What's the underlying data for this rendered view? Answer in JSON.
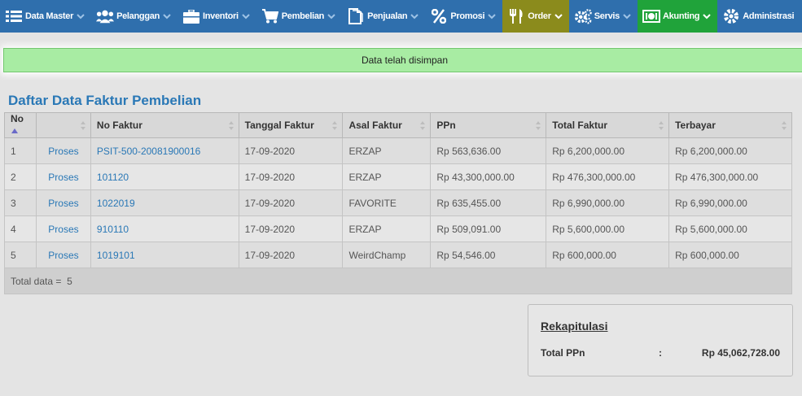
{
  "nav": [
    {
      "key": "data-master",
      "label": "Data Master",
      "icon": "list-icon"
    },
    {
      "key": "pelanggan",
      "label": "Pelanggan",
      "icon": "users-icon"
    },
    {
      "key": "inventori",
      "label": "Inventori",
      "icon": "briefcase-icon"
    },
    {
      "key": "pembelian",
      "label": "Pembelian",
      "icon": "cart-icon"
    },
    {
      "key": "penjualan",
      "label": "Penjualan",
      "icon": "document-icon"
    },
    {
      "key": "promosi",
      "label": "Promosi",
      "icon": "percent-icon"
    },
    {
      "key": "order",
      "label": "Order",
      "icon": "utensils-icon"
    },
    {
      "key": "servis",
      "label": "Servis",
      "icon": "gears-icon"
    },
    {
      "key": "akunting",
      "label": "Akunting",
      "icon": "money-icon"
    },
    {
      "key": "administrasi",
      "label": "Administrasi",
      "icon": "gear-icon"
    }
  ],
  "alert": {
    "message": "Data telah disimpan"
  },
  "page": {
    "title": "Daftar Data Faktur Pembelian"
  },
  "table": {
    "headers": {
      "no": "No",
      "aksi": "",
      "no_faktur": "No Faktur",
      "tanggal": "Tanggal Faktur",
      "asal": "Asal Faktur",
      "ppn": "PPn",
      "total": "Total Faktur",
      "terbayar": "Terbayar"
    },
    "rows": [
      {
        "no": "1",
        "aksi": "Proses",
        "no_faktur": "PSIT-500-20081900016",
        "tanggal": "17-09-2020",
        "asal": "ERZAP",
        "ppn": "Rp 563,636.00",
        "total": "Rp 6,200,000.00",
        "terbayar": "Rp 6,200,000.00"
      },
      {
        "no": "2",
        "aksi": "Proses",
        "no_faktur": "101120",
        "tanggal": "17-09-2020",
        "asal": "ERZAP",
        "ppn": "Rp 43,300,000.00",
        "total": "Rp 476,300,000.00",
        "terbayar": "Rp 476,300,000.00"
      },
      {
        "no": "3",
        "aksi": "Proses",
        "no_faktur": "1022019",
        "tanggal": "17-09-2020",
        "asal": "FAVORITE",
        "ppn": "Rp 635,455.00",
        "total": "Rp 6,990,000.00",
        "terbayar": "Rp 6,990,000.00"
      },
      {
        "no": "4",
        "aksi": "Proses",
        "no_faktur": "910110",
        "tanggal": "17-09-2020",
        "asal": "ERZAP",
        "ppn": "Rp 509,091.00",
        "total": "Rp 5,600,000.00",
        "terbayar": "Rp 5,600,000.00"
      },
      {
        "no": "5",
        "aksi": "Proses",
        "no_faktur": "1019101",
        "tanggal": "17-09-2020",
        "asal": "WeirdChamp",
        "ppn": "Rp 54,546.00",
        "total": "Rp 600,000.00",
        "terbayar": "Rp 600,000.00"
      }
    ],
    "footer": {
      "label": "Total data =",
      "count": "5"
    }
  },
  "rekap": {
    "title": "Rekapitulasi",
    "label": "Total PPn",
    "colon": ":",
    "value": "Rp 45,062,728.00"
  },
  "colors": {
    "nav_bg": "#2f6fad",
    "order_bg": "#8b8b1c",
    "akunting_bg": "#20a33a",
    "alert_bg": "#a8eca3",
    "link": "#2a78b6"
  }
}
